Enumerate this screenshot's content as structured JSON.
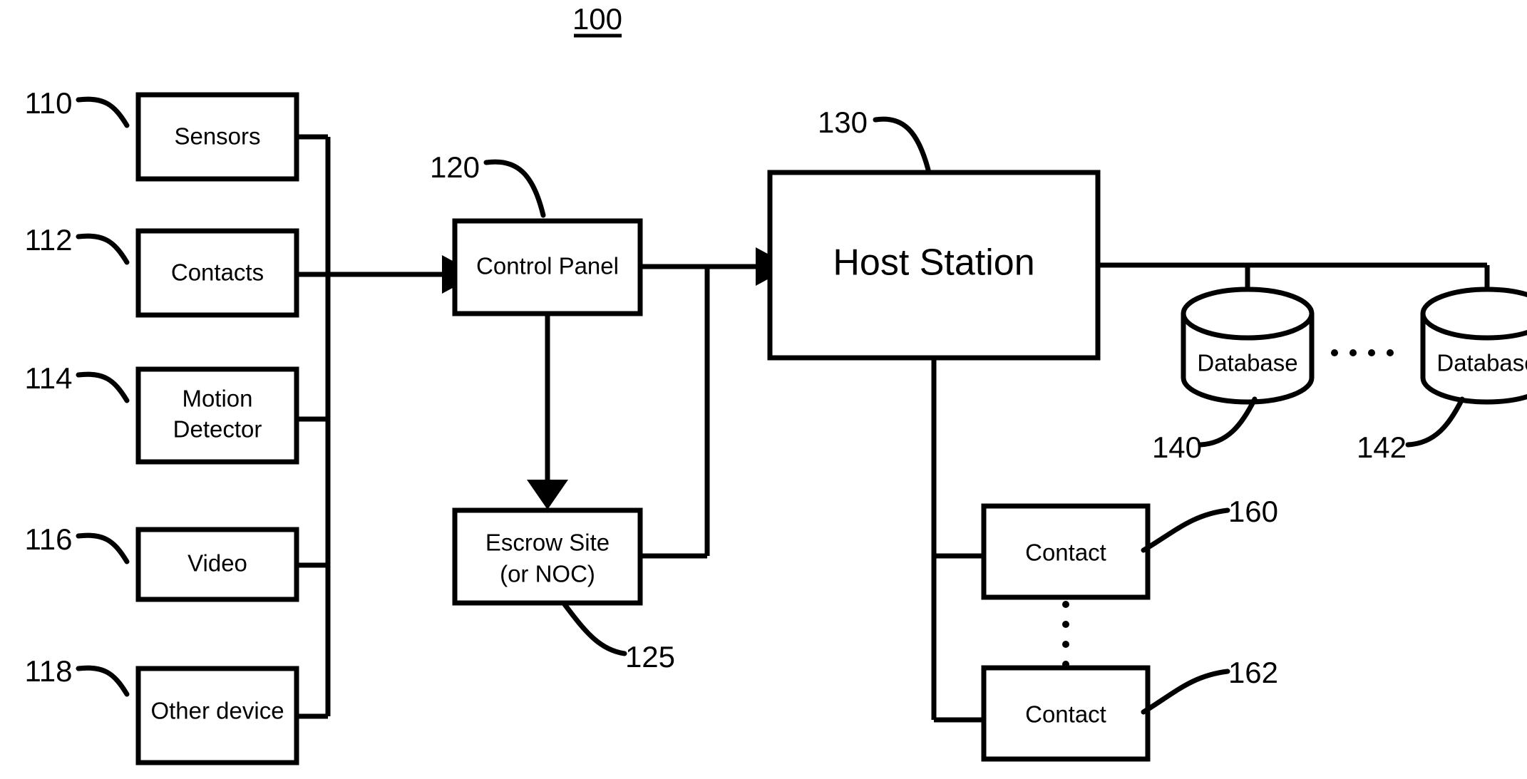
{
  "figure": {
    "number": "100",
    "underlined": true,
    "background_color": "#ffffff",
    "line_color": "#000000"
  },
  "blocks": [
    {
      "id": "sensors",
      "label": "Sensors",
      "ref": "110"
    },
    {
      "id": "contacts",
      "label": "Contacts",
      "ref": "112"
    },
    {
      "id": "motion",
      "label_line1": "Motion",
      "label_line2": "Detector",
      "ref": "114"
    },
    {
      "id": "video",
      "label": "Video",
      "ref": "116"
    },
    {
      "id": "other-device",
      "label": "Other device",
      "ref": "118"
    },
    {
      "id": "control-panel",
      "label": "Control Panel",
      "ref": "120"
    },
    {
      "id": "escrow-site",
      "label_line1": "Escrow Site",
      "label_line2": "(or NOC)",
      "ref": "125"
    },
    {
      "id": "host-station",
      "label": "Host Station",
      "ref": "130"
    },
    {
      "id": "database-1",
      "label": "Database",
      "ref": "140"
    },
    {
      "id": "database-2",
      "label": "Database",
      "ref": "142"
    },
    {
      "id": "contact-1",
      "label": "Contact",
      "ref": "160"
    },
    {
      "id": "contact-2",
      "label": "Contact",
      "ref": "162"
    }
  ],
  "labels": {
    "sensors": "Sensors",
    "contacts": "Contacts",
    "motion_l1": "Motion",
    "motion_l2": "Detector",
    "video": "Video",
    "other_device": "Other device",
    "control_panel": "Control Panel",
    "escrow_l1": "Escrow Site",
    "escrow_l2": "(or NOC)",
    "host_station": "Host Station",
    "database_1": "Database",
    "database_2": "Database",
    "contact_1": "Contact",
    "contact_2": "Contact"
  },
  "refs": {
    "fig": "100",
    "sensors": "110",
    "contacts": "112",
    "motion": "114",
    "video": "116",
    "other_device": "118",
    "control_panel": "120",
    "escrow": "125",
    "host_station": "130",
    "database_1": "140",
    "database_2": "142",
    "contact_1": "160",
    "contact_2": "162"
  },
  "connections": [
    {
      "from": "sensors",
      "to": "control-panel",
      "style": "bus"
    },
    {
      "from": "contacts",
      "to": "control-panel",
      "style": "arrow"
    },
    {
      "from": "motion",
      "to": "control-panel",
      "style": "bus"
    },
    {
      "from": "video",
      "to": "control-panel",
      "style": "bus"
    },
    {
      "from": "other-device",
      "to": "control-panel",
      "style": "bus"
    },
    {
      "from": "control-panel",
      "to": "host-station",
      "style": "arrow"
    },
    {
      "from": "control-panel",
      "to": "escrow-site",
      "style": "arrow-down"
    },
    {
      "from": "escrow-site",
      "to": "host-station",
      "style": "line"
    },
    {
      "from": "host-station",
      "to": "database-1",
      "style": "line"
    },
    {
      "from": "host-station",
      "to": "database-2",
      "style": "line"
    },
    {
      "from": "host-station",
      "to": "contact-1",
      "style": "line"
    },
    {
      "from": "host-station",
      "to": "contact-2",
      "style": "line"
    }
  ],
  "ellipses": {
    "between_databases": "horizontal-dots",
    "between_contacts": "vertical-dots"
  }
}
